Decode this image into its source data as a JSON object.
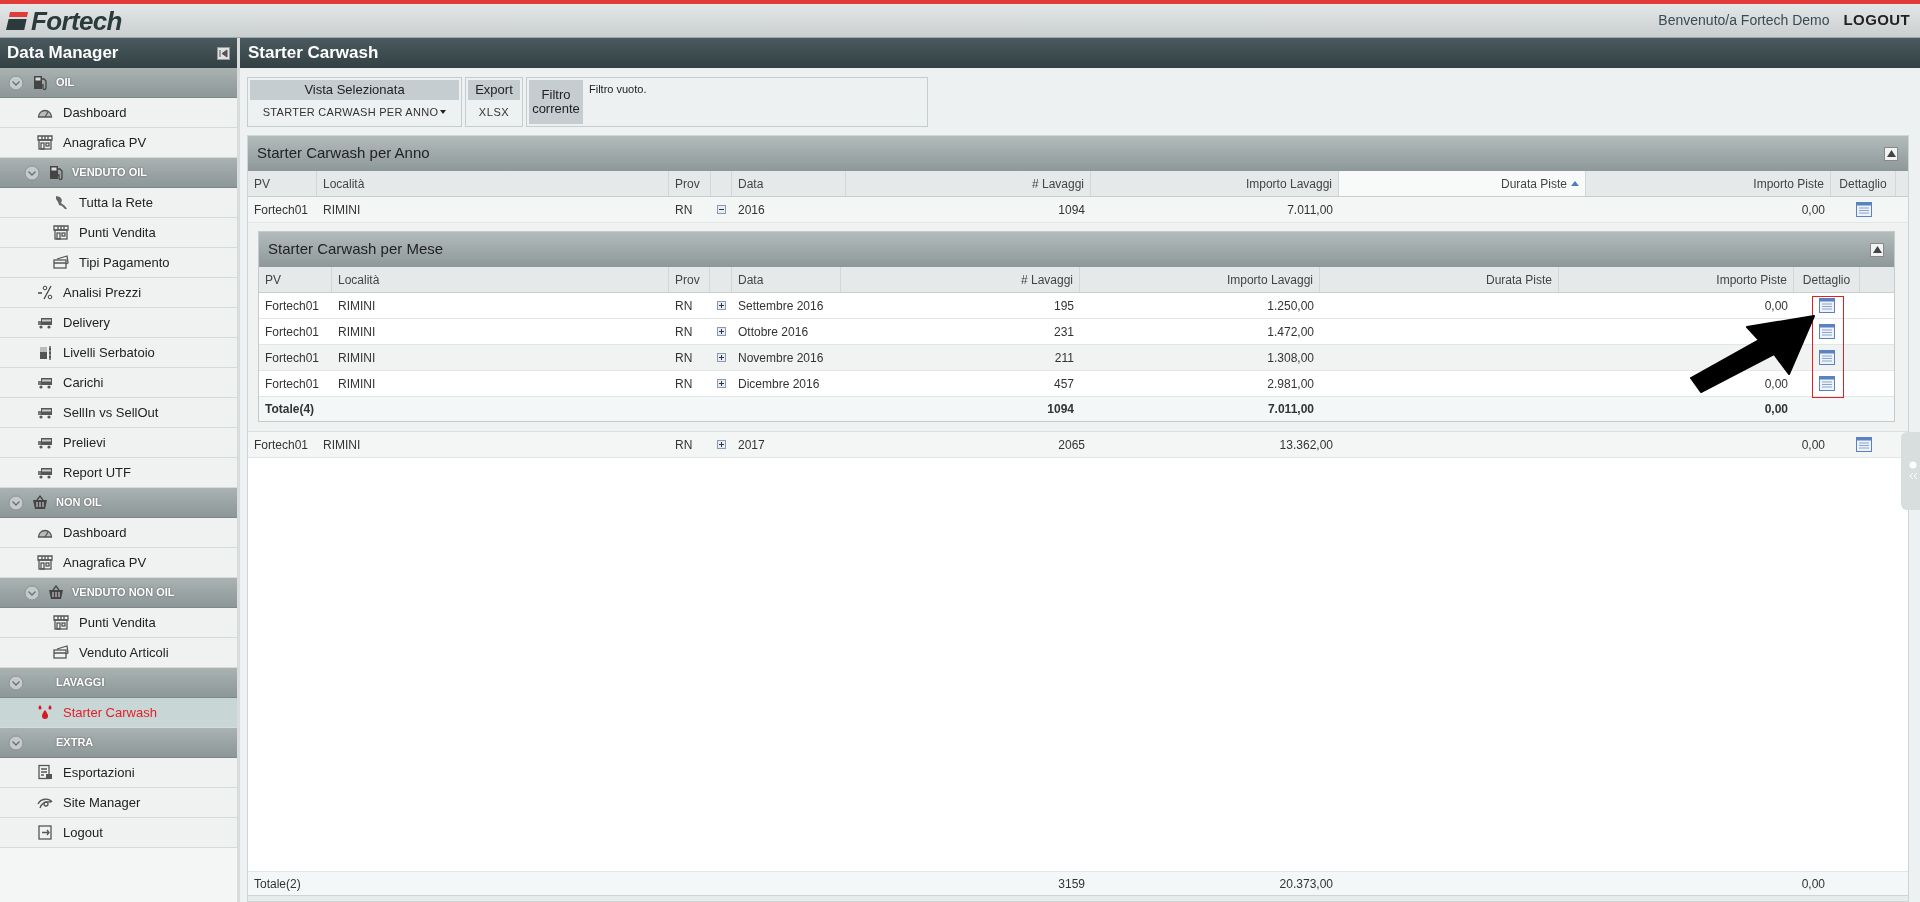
{
  "header": {
    "logo": "Fortech",
    "welcome": "Benvenuto/a Fortech Demo",
    "logout": "LOGOUT"
  },
  "sidebar": {
    "title": "Data Manager",
    "items": [
      {
        "kind": "section",
        "label": "OIL",
        "expanded": true,
        "children": [
          {
            "kind": "item",
            "label": "Dashboard",
            "selected": false
          },
          {
            "kind": "item",
            "label": "Anagrafica PV",
            "selected": false
          },
          {
            "kind": "section",
            "label": "VENDUTO OIL",
            "expanded": true,
            "children": [
              {
                "kind": "item",
                "label": "Tutta la Rete",
                "selected": false
              },
              {
                "kind": "item",
                "label": "Punti Vendita",
                "selected": false
              },
              {
                "kind": "item",
                "label": "Tipi Pagamento",
                "selected": false
              }
            ]
          },
          {
            "kind": "item",
            "label": "Analisi Prezzi",
            "selected": false
          },
          {
            "kind": "item",
            "label": "Delivery",
            "selected": false
          },
          {
            "kind": "item",
            "label": "Livelli Serbatoio",
            "selected": false
          },
          {
            "kind": "item",
            "label": "Carichi",
            "selected": false
          },
          {
            "kind": "item",
            "label": "SellIn vs SellOut",
            "selected": false
          },
          {
            "kind": "item",
            "label": "Prelievi",
            "selected": false
          },
          {
            "kind": "item",
            "label": "Report UTF",
            "selected": false
          }
        ]
      },
      {
        "kind": "section",
        "label": "NON OIL",
        "expanded": true,
        "children": [
          {
            "kind": "item",
            "label": "Dashboard",
            "selected": false
          },
          {
            "kind": "item",
            "label": "Anagrafica PV",
            "selected": false
          },
          {
            "kind": "section",
            "label": "VENDUTO NON OIL",
            "expanded": true,
            "children": [
              {
                "kind": "item",
                "label": "Punti Vendita",
                "selected": false
              },
              {
                "kind": "item",
                "label": "Venduto Articoli",
                "selected": false
              }
            ]
          }
        ]
      },
      {
        "kind": "section",
        "label": "LAVAGGI",
        "expanded": true,
        "children": [
          {
            "kind": "item",
            "label": "Starter Carwash",
            "selected": true
          }
        ]
      },
      {
        "kind": "section",
        "label": "EXTRA",
        "expanded": true,
        "children": [
          {
            "kind": "item",
            "label": "Esportazioni",
            "selected": false
          },
          {
            "kind": "item",
            "label": "Site Manager",
            "selected": false
          },
          {
            "kind": "item",
            "label": "Logout",
            "selected": false
          }
        ]
      }
    ]
  },
  "page_title": "Starter Carwash",
  "toolbar": {
    "view": {
      "label": "Vista Selezionata",
      "value": "STARTER CARWASH PER ANNO"
    },
    "export": {
      "label": "Export",
      "value": "XLSX"
    },
    "filter": {
      "label": "Filtro corrente",
      "text": "Filtro vuoto."
    }
  },
  "grid": {
    "title": "Starter Carwash per Anno",
    "collapsed": false,
    "columns": [
      {
        "label": "PV",
        "sorted": false
      },
      {
        "label": "Località",
        "sorted": false
      },
      {
        "label": "Prov",
        "sorted": false
      },
      {
        "label": "Data",
        "sorted": false
      },
      {
        "label": "# Lavaggi",
        "sorted": false
      },
      {
        "label": "Importo Lavaggi",
        "sorted": false
      },
      {
        "label": "Durata Piste",
        "sorted": true
      },
      {
        "label": "Importo Piste",
        "sorted": false
      },
      {
        "label": "Dettaglio",
        "sorted": false
      }
    ],
    "rows": [
      {
        "pv": "Fortech01",
        "localita": "RIMINI",
        "prov": "RN",
        "expanded": true,
        "data": "2016",
        "lavaggi": "1094",
        "importo_lavaggi": "7.011,00",
        "importo_piste": "0,00",
        "subgrid": {
          "title": "Starter Carwash per Mese",
          "collapsed": false,
          "columns": [
            {
              "label": "PV"
            },
            {
              "label": "Località"
            },
            {
              "label": "Prov"
            },
            {
              "label": "Data"
            },
            {
              "label": "# Lavaggi"
            },
            {
              "label": "Importo Lavaggi"
            },
            {
              "label": "Durata Piste"
            },
            {
              "label": "Importo Piste"
            },
            {
              "label": "Dettaglio"
            }
          ],
          "rows": [
            {
              "pv": "Fortech01",
              "localita": "RIMINI",
              "prov": "RN",
              "expanded": false,
              "data": "Settembre 2016",
              "lavaggi": "195",
              "importo_lavaggi": "1.250,00",
              "importo_piste": "0,00"
            },
            {
              "pv": "Fortech01",
              "localita": "RIMINI",
              "prov": "RN",
              "expanded": false,
              "data": "Ottobre 2016",
              "lavaggi": "231",
              "importo_lavaggi": "1.472,00"
            },
            {
              "pv": "Fortech01",
              "localita": "RIMINI",
              "prov": "RN",
              "expanded": false,
              "data": "Novembre 2016",
              "lavaggi": "211",
              "importo_lavaggi": "1.308,00"
            },
            {
              "pv": "Fortech01",
              "localita": "RIMINI",
              "prov": "RN",
              "expanded": false,
              "data": "Dicembre 2016",
              "lavaggi": "457",
              "importo_lavaggi": "2.981,00",
              "importo_piste": "0,00"
            }
          ],
          "total": {
            "label": "Totale(4)",
            "lavaggi": "1094",
            "importo_lavaggi": "7.011,00",
            "importo_piste": "0,00"
          }
        }
      },
      {
        "pv": "Fortech01",
        "localita": "RIMINI",
        "prov": "RN",
        "expanded": false,
        "data": "2017",
        "lavaggi": "2065",
        "importo_lavaggi": "13.362,00",
        "importo_piste": "0,00"
      }
    ],
    "total": {
      "label": "Totale(2)",
      "lavaggi": "3159",
      "importo_lavaggi": "20.373,00",
      "importo_piste": "0,00"
    }
  }
}
